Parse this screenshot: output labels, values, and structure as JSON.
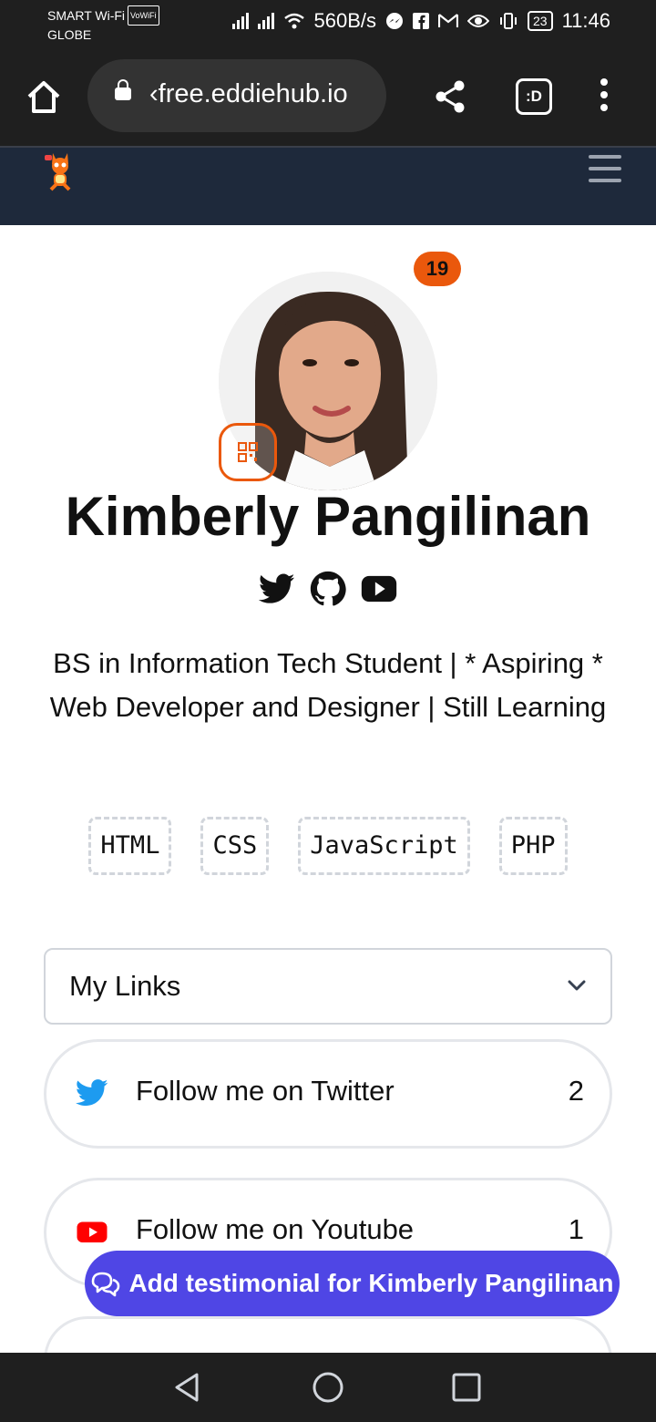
{
  "status_bar": {
    "carrier_top": "SMART Wi-Fi",
    "vowifi": "VoWiFi",
    "carrier_bottom": "GLOBE",
    "speed": "560B/s",
    "battery": "23",
    "time": "11:46"
  },
  "browser": {
    "url": "‹free.eddiehub.io",
    "tabs_label": ":D"
  },
  "profile": {
    "views_badge": "19",
    "name": "Kimberly Pangilinan",
    "bio": "BS in Information Tech Student | * Aspiring * Web Developer and Designer | Still Learning",
    "tags": [
      "HTML",
      "CSS",
      "JavaScript",
      "PHP"
    ]
  },
  "links": {
    "section_label": "My Links",
    "items": [
      {
        "label": "Follow me on Twitter",
        "count": "2",
        "icon": "twitter-icon"
      },
      {
        "label": "Follow me on Youtube",
        "count": "1",
        "icon": "youtube-icon"
      }
    ]
  },
  "cta": {
    "label": "Add testimonial for Kimberly Pangilinan"
  },
  "colors": {
    "accent_orange": "#ea580c",
    "cta_indigo": "#4f46e5",
    "nav_dark": "#1e293b",
    "twitter_blue": "#1d9bf0",
    "youtube_red": "#ff0000"
  }
}
